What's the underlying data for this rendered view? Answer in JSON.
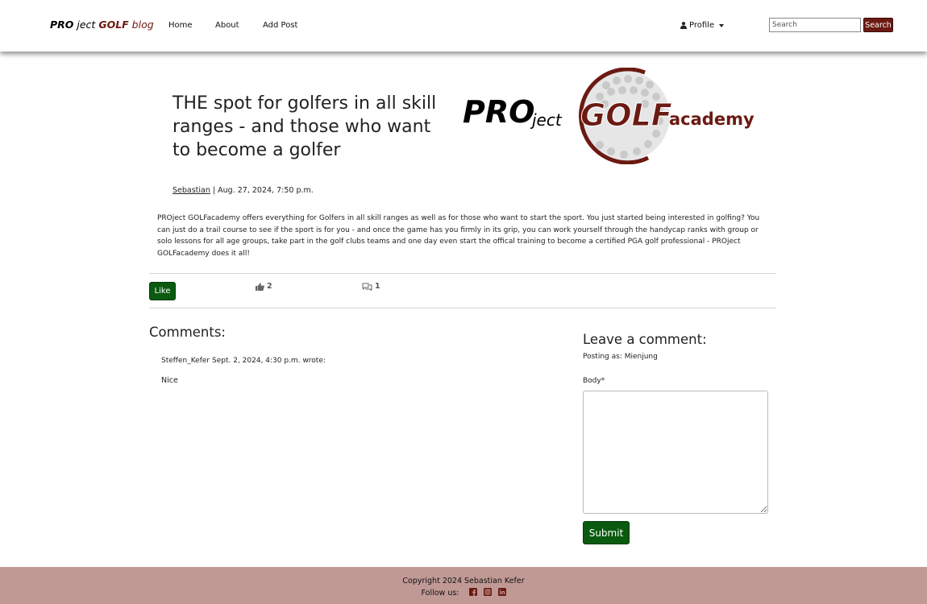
{
  "navbar": {
    "brand": {
      "part1": "PRO",
      "part2": " ject ",
      "part3": "GOLF",
      "part4": " blog"
    },
    "links": [
      "Home",
      "About",
      "Add Post"
    ],
    "profile_label": "Profile",
    "search_placeholder": "Search",
    "search_button": "Search"
  },
  "post": {
    "title": "THE spot for golfers in all skill ranges - and those who want to become a golfer",
    "logo": {
      "pro": "PRO",
      "ject": "ject",
      "golf": "GOLF",
      "academy": "academy"
    },
    "author": "Sebastian",
    "date": "Aug. 27, 2024, 7:50 p.m.",
    "content": "PROject GOLFacademy offers everything for Golfers in all skill ranges as well as for those who want to start the sport. You just started being interested in golfing? You can just do a trail course to see if the sport is for you - and once the game has you firmly in its grip, you can work yourself through the handycap ranks with group or solo lessons for all age groups, take part in the golf clubs teams and one day even start the offical training to become a certified PGA golf professional - PROject GOLFacademy does it all!"
  },
  "actions": {
    "like_button": "Like",
    "like_count": "2",
    "comment_count": "1"
  },
  "comments": {
    "heading": "Comments:",
    "items": [
      {
        "author": "Steffen_Kefer",
        "date": "Sept. 2, 2024, 4:30 p.m.",
        "suffix": "wrote:",
        "body": "Nice"
      }
    ]
  },
  "comment_form": {
    "heading": "Leave a comment:",
    "posting_as": "Posting as: Mienjung",
    "body_label": "Body*",
    "submit": "Submit"
  },
  "footer": {
    "copyright": "Copyright 2024 Sebastian Kefer",
    "follow_label": "Follow us:",
    "social_icons": [
      "facebook-icon",
      "instagram-icon",
      "linkedin-icon"
    ]
  },
  "colors": {
    "brand_red": "#6b1a12",
    "like_green": "#0a5a10",
    "footer_bg": "#c09995"
  }
}
